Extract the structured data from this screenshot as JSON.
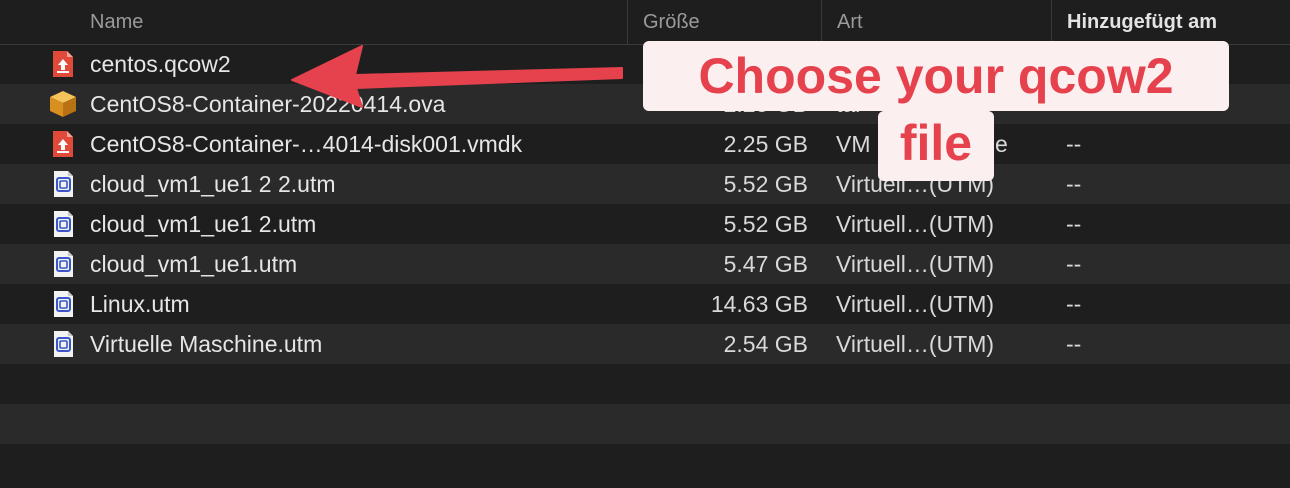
{
  "header": {
    "name_label": "Name",
    "size_label": "Größe",
    "kind_label": "Art",
    "added_label": "Hinzugefügt am"
  },
  "files": [
    {
      "name": "centos.qcow2",
      "size": "",
      "kind": "",
      "date": "",
      "icon": "document-icon"
    },
    {
      "name": "CentOS8-Container-20220414.ova",
      "size": "2.25 GB",
      "kind": "tar",
      "date": "--",
      "icon": "package-icon"
    },
    {
      "name": "CentOS8-Container-…4014-disk001.vmdk",
      "size": "2.25 GB",
      "kind": "VM",
      "kind_tail": "e",
      "date": "--",
      "icon": "document-icon"
    },
    {
      "name": "cloud_vm1_ue1 2 2.utm",
      "size": "5.52 GB",
      "kind": "Virtuell…(UTM)",
      "date": "--",
      "icon": "utm-icon"
    },
    {
      "name": "cloud_vm1_ue1 2.utm",
      "size": "5.52 GB",
      "kind": "Virtuell…(UTM)",
      "date": "--",
      "icon": "utm-icon"
    },
    {
      "name": "cloud_vm1_ue1.utm",
      "size": "5.47 GB",
      "kind": "Virtuell…(UTM)",
      "date": "--",
      "icon": "utm-icon"
    },
    {
      "name": "Linux.utm",
      "size": "14.63 GB",
      "kind": "Virtuell…(UTM)",
      "date": "--",
      "icon": "utm-icon"
    },
    {
      "name": "Virtuelle Maschine.utm",
      "size": "2.54 GB",
      "kind": "Virtuell…(UTM)",
      "date": "--",
      "icon": "utm-icon"
    }
  ],
  "annotation": {
    "line1": "Choose your qcow2",
    "line2": "file",
    "color": "#e5424e"
  }
}
